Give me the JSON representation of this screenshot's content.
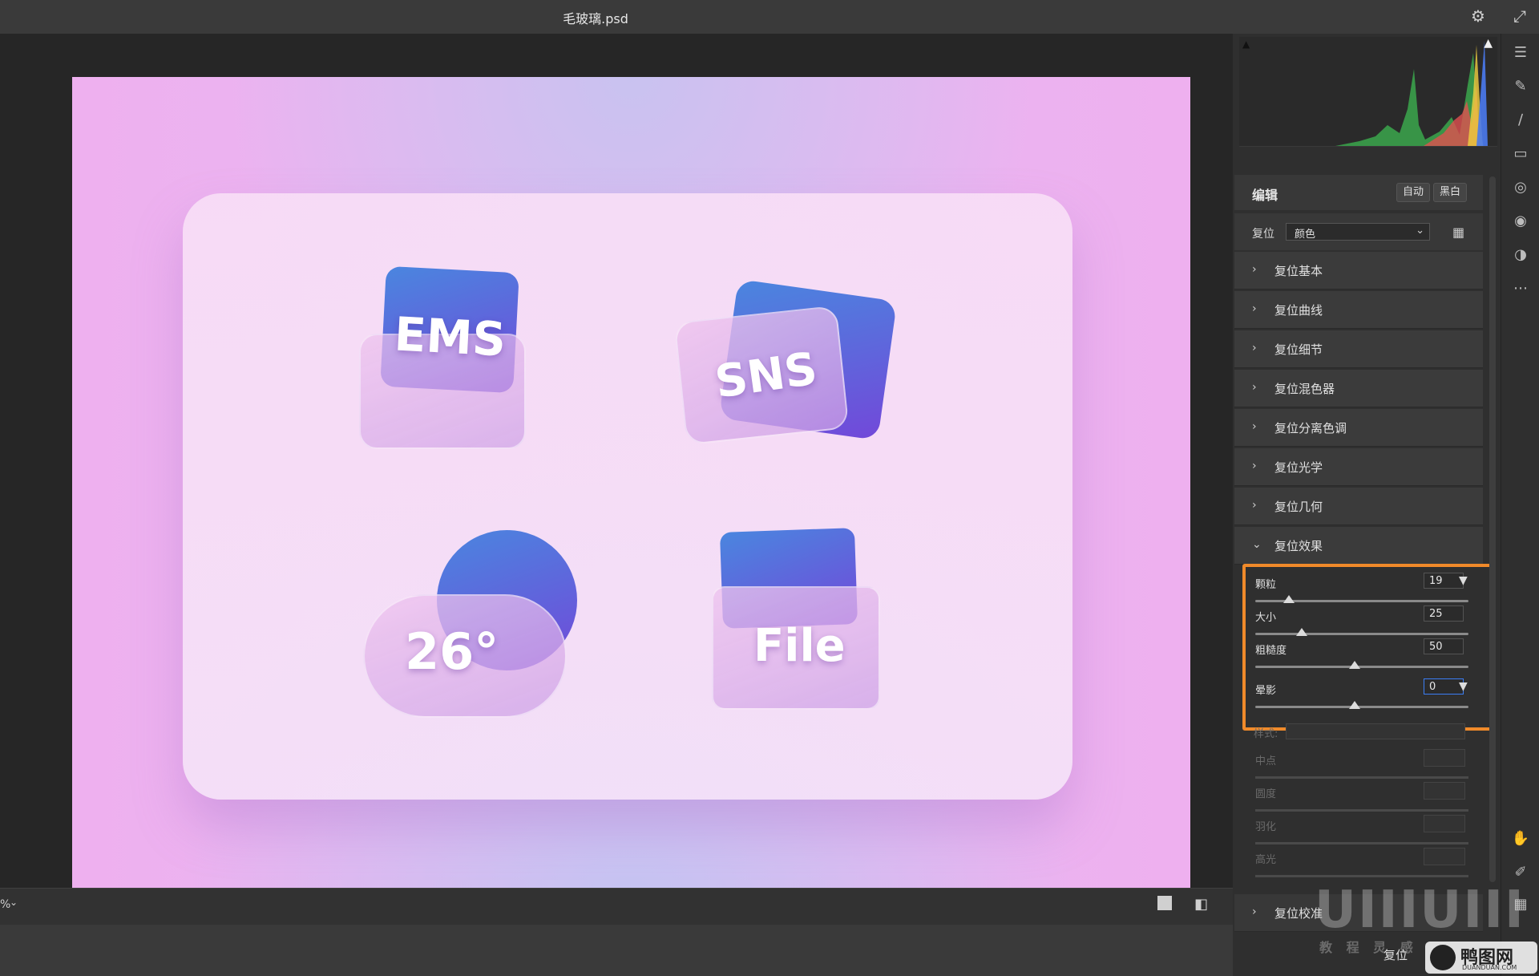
{
  "window": {
    "title": "毛玻璃.psd"
  },
  "icons_titlebar": [
    "gear-icon",
    "expand-icon"
  ],
  "artwork": {
    "card_icons": [
      {
        "name": "mail-envelope",
        "label": "EMS"
      },
      {
        "name": "chat-bubbles",
        "label": "SNS"
      },
      {
        "name": "weather-cloud-sun",
        "label": "26°"
      },
      {
        "name": "folder-file",
        "label": "File"
      }
    ]
  },
  "panel": {
    "edit": {
      "title": "编辑",
      "auto_label": "自动",
      "bw_label": "黑白"
    },
    "profile": {
      "reset_label": "复位",
      "selected": "颜色"
    },
    "sections": [
      "复位基本",
      "复位曲线",
      "复位细节",
      "复位混色器",
      "复位分离色调",
      "复位光学",
      "复位几何",
      "复位效果"
    ],
    "effects": {
      "grain": {
        "label": "颗粒",
        "value": "19"
      },
      "size": {
        "label": "大小",
        "value": "25"
      },
      "roughness": {
        "label": "粗糙度",
        "value": "50"
      },
      "vignette": {
        "label": "晕影",
        "value": "0"
      }
    },
    "disabled": {
      "style_label": "样式:",
      "midpoint": "中点",
      "roundness": "圆度",
      "feather": "羽化",
      "highlights": "高光"
    },
    "calibration": "复位校准",
    "footer_reset": "复位"
  },
  "watermark": {
    "brand": "UIIIUIII",
    "sub": "教 程 灵 感",
    "site_cn": "鸭图网",
    "site_url": "DUANDUAN.COM"
  },
  "zoom_label": "%",
  "colors": {
    "accent_highlight": "#f08a2a",
    "panel_bg": "#2f2f2f"
  }
}
